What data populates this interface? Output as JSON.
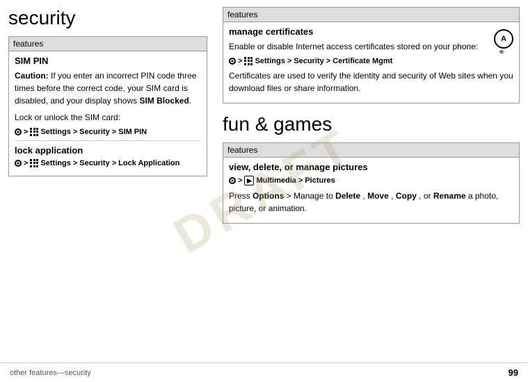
{
  "page": {
    "left_title": "security",
    "right_section_title": "fun & games",
    "footer_text": "other features—security",
    "page_number": "99",
    "draft_label": "DRAFT"
  },
  "left_features": {
    "header": "features",
    "blocks": [
      {
        "id": "sim-pin",
        "title": "SIM PIN",
        "text_parts": [
          {
            "type": "bold-prefix",
            "bold": "Caution:",
            "text": " If you enter an incorrect PIN code three times before the correct code, your SIM card is disabled, and your display shows "
          },
          {
            "type": "bold-suffix",
            "text": "SIM Blocked",
            "suffix": "."
          }
        ],
        "caution_text": "If you enter an incorrect PIN code three times before the correct code, your SIM card is disabled, and your display shows",
        "caution_bold": "SIM Blocked",
        "lock_text": "Lock or unlock the SIM card:",
        "nav_path": "· > ⚙ Settings > Security > SIM PIN",
        "nav_label": "SIM PIN"
      }
    ],
    "lock_app": {
      "title": "lock application",
      "nav_label": "Lock Application"
    }
  },
  "right_features_top": {
    "header": "features",
    "title": "manage certificates",
    "description_1": "Enable or disable Internet access certificates stored on your phone:",
    "nav_label": "Certificate Mgmt",
    "description_2": "Certificates are used to verify the identity and security of Web sites when you download files or share information."
  },
  "right_features_bottom": {
    "header": "features",
    "title": "view, delete, or manage pictures",
    "nav_label": "Pictures",
    "multimedia_path": "Multimedia",
    "description": "Press Options > Manage to Delete, Move, Copy, or Rename a photo, picture, or animation."
  }
}
